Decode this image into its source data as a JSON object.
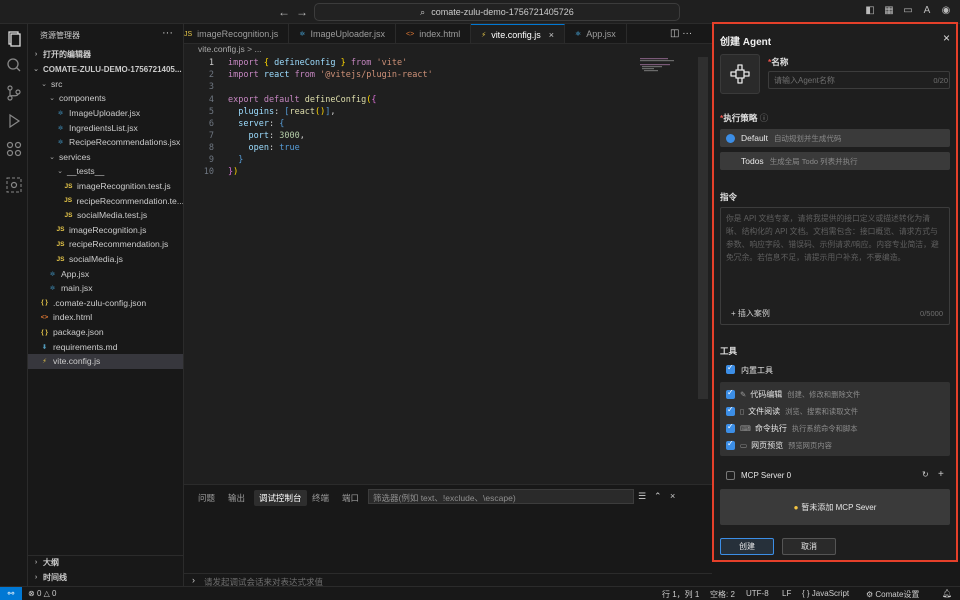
{
  "titlebar": {
    "search_text": "comate-zulu-demo-1756721405726"
  },
  "explorer": {
    "title": "资源管理器",
    "open_editors": "打开的编辑器",
    "project": "COMATE-ZULU-DEMO-1756721405...",
    "tree": [
      {
        "label": "src",
        "type": "folder",
        "depth": 1
      },
      {
        "label": "components",
        "type": "folder",
        "depth": 2
      },
      {
        "label": "ImageUploader.jsx",
        "type": "react",
        "depth": 3
      },
      {
        "label": "IngredientsList.jsx",
        "type": "react",
        "depth": 3
      },
      {
        "label": "RecipeRecommendations.jsx",
        "type": "react",
        "depth": 3
      },
      {
        "label": "services",
        "type": "folder",
        "depth": 2
      },
      {
        "label": "__tests__",
        "type": "folder",
        "depth": 3
      },
      {
        "label": "imageRecognition.test.js",
        "type": "js",
        "depth": 4
      },
      {
        "label": "recipeRecommendation.te...",
        "type": "js",
        "depth": 4
      },
      {
        "label": "socialMedia.test.js",
        "type": "js",
        "depth": 4
      },
      {
        "label": "imageRecognition.js",
        "type": "js",
        "depth": 3
      },
      {
        "label": "recipeRecommendation.js",
        "type": "js",
        "depth": 3
      },
      {
        "label": "socialMedia.js",
        "type": "js",
        "depth": 3
      },
      {
        "label": "App.jsx",
        "type": "react",
        "depth": 2
      },
      {
        "label": "main.jsx",
        "type": "react",
        "depth": 2
      },
      {
        "label": ".comate-zulu-config.json",
        "type": "json",
        "depth": 1
      },
      {
        "label": "index.html",
        "type": "html",
        "depth": 1
      },
      {
        "label": "package.json",
        "type": "json",
        "depth": 1
      },
      {
        "label": "requirements.md",
        "type": "md",
        "depth": 1
      },
      {
        "label": "vite.config.js",
        "type": "vite",
        "depth": 1
      }
    ],
    "outline": "大纲",
    "timeline": "时间线"
  },
  "tabs": [
    {
      "label": "imageRecognition.js",
      "icon": "JS"
    },
    {
      "label": "ImageUploader.jsx",
      "icon": "⚛"
    },
    {
      "label": "index.html",
      "icon": "<>"
    },
    {
      "label": "vite.config.js",
      "icon": "⚡"
    },
    {
      "label": "App.jsx",
      "icon": "⚛"
    }
  ],
  "breadcrumb": "vite.config.js > ...",
  "code_lines": [
    "1",
    "2",
    "3",
    "4",
    "5",
    "6",
    "7",
    "8",
    "9",
    "10"
  ],
  "panel": {
    "tabs": [
      "问题",
      "输出",
      "调试控制台",
      "终端",
      "端口"
    ],
    "filter_placeholder": "筛选器(例如 text、!exclude、\\escape)",
    "debug_placeholder": "请发起调试会话来对表达式求值"
  },
  "status": {
    "errors": "0",
    "warnings": "0",
    "position": "行 1，列 1",
    "spaces": "空格: 2",
    "encoding": "UTF-8",
    "eol": "LF",
    "language": "JavaScript",
    "comate": "Comate设置"
  },
  "agent": {
    "title": "创建 Agent",
    "name_label": "名称",
    "name_placeholder": "请输入Agent名称",
    "name_count": "0/20",
    "strategy_label": "执行策略",
    "strategies": [
      {
        "name": "Default",
        "desc": "自动规划并生成代码"
      },
      {
        "name": "Todos",
        "desc": "生成全局 Todo 列表并执行"
      }
    ],
    "instruction_label": "指令",
    "instruction_placeholder": "你是 API 文档专家，请将我提供的接口定义或描述转化为清晰、结构化的 API 文档。文档需包含：接口概览、请求方式与参数、响应字段、错误码、示例请求/响应。内容专业简洁，避免冗余。若信息不足，请提示用户补充，不要编造。",
    "insert_example": "插入案例",
    "instruction_count": "0/5000",
    "tools_label": "工具",
    "builtin_tools": "内置工具",
    "tools": [
      {
        "name": "代码编辑",
        "desc": "创建、修改和删除文件"
      },
      {
        "name": "文件阅读",
        "desc": "浏览、搜索和读取文件"
      },
      {
        "name": "命令执行",
        "desc": "执行系统命令和脚本"
      },
      {
        "name": "网页预览",
        "desc": "预览网页内容"
      }
    ],
    "mcp_label": "MCP Server 0",
    "mcp_empty": "暂未添加 MCP Sever",
    "create_button": "创建",
    "cancel_button": "取消"
  }
}
